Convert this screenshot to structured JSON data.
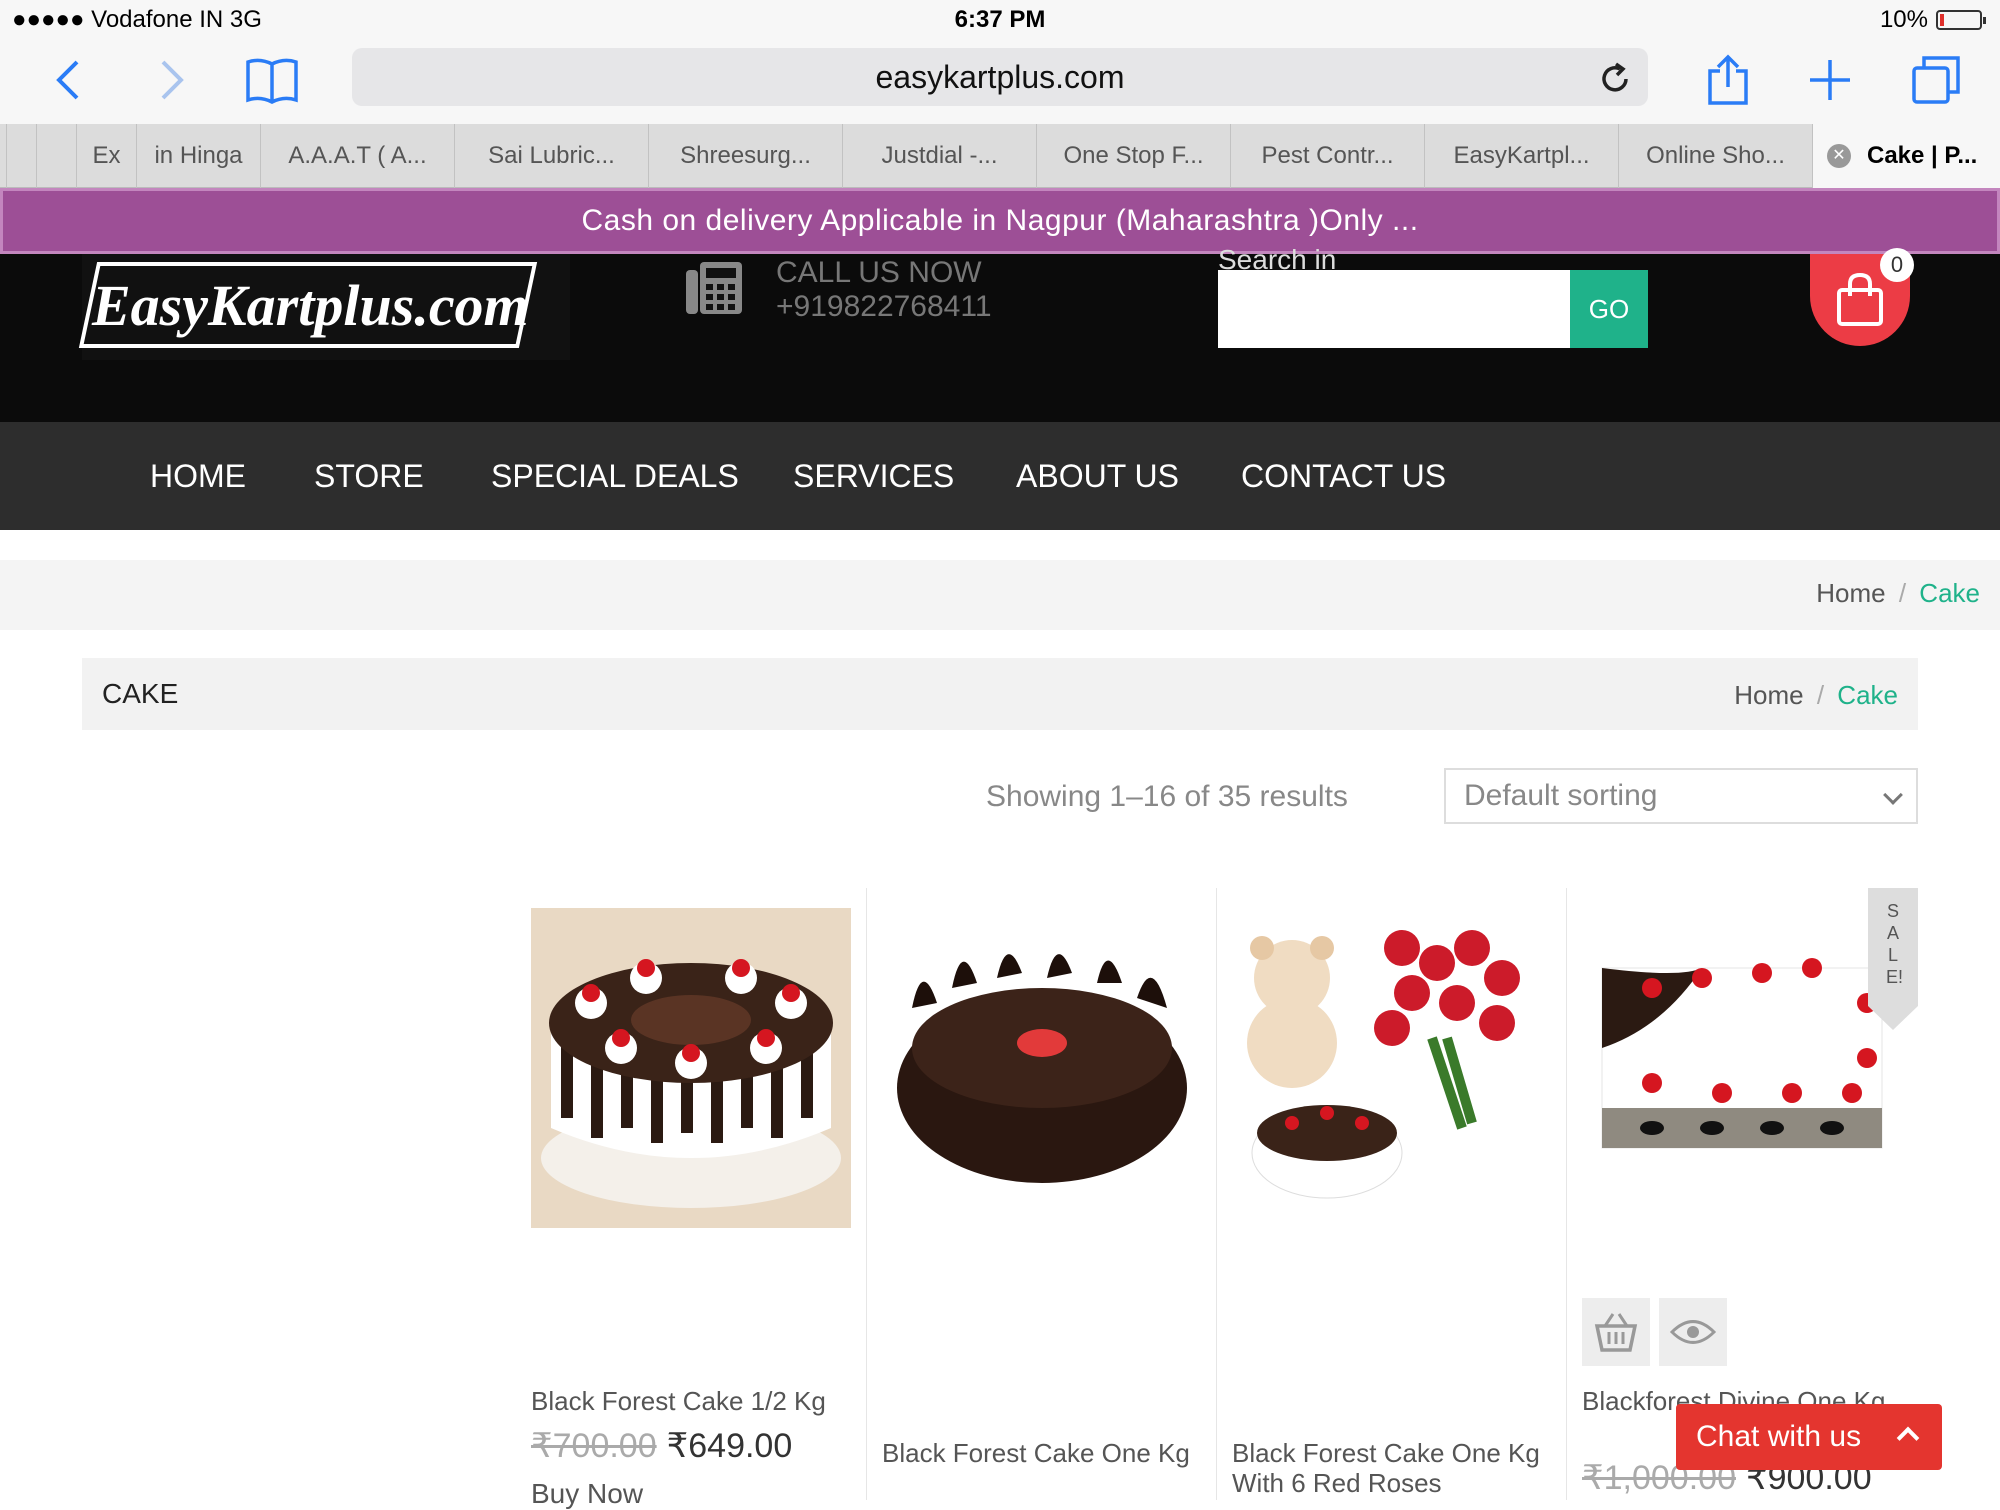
{
  "status": {
    "carrier": "●●●●● Vodafone IN  3G",
    "time": "6:37 PM",
    "battery": "10%",
    "battery_level": 0.1
  },
  "browser": {
    "url": "easykartplus.com",
    "tabs": [
      "Ex",
      "in Hinga",
      "A.A.A.T ( A...",
      "Sai Lubric...",
      "Shreesurg...",
      "Justdial -...",
      "One Stop F...",
      "Pest Contr...",
      "EasyKartpl...",
      "Online Sho...",
      "Cake | P..."
    ]
  },
  "notice": "Cash on delivery Applicable in Nagpur (Maharashtra )Only ...",
  "header": {
    "logo": "EasyKartplus.com",
    "call_label": "CALL US NOW",
    "call_number": "+919822768411",
    "search_label": "Search in",
    "go": "GO",
    "cart_count": "0"
  },
  "nav": [
    "HOME",
    "STORE",
    "SPECIAL DEALS",
    "SERVICES",
    "ABOUT US",
    "CONTACT US"
  ],
  "breadcrumb": {
    "home": "Home",
    "sep": "/",
    "current": "Cake"
  },
  "page": {
    "title": "CAKE",
    "results": "Showing 1–16 of 35 results",
    "sorting": "Default sorting"
  },
  "products": [
    {
      "name": "Black Forest Cake 1/2 Kg",
      "old_price": "₹700.00",
      "price": "₹649.00",
      "cta": "Buy Now"
    },
    {
      "name": "Black Forest Cake One Kg"
    },
    {
      "name": "Black Forest Cake One Kg With 6 Red Roses"
    },
    {
      "name": "Blackforest Divine One Kg",
      "old_price": "₹1,000.00",
      "price": "₹900.00",
      "sale": "SALE!"
    }
  ],
  "chat": "Chat with us",
  "colors": {
    "accent": "#1fb28a",
    "notice": "#9d4f96",
    "cart": "#ec3c45",
    "chat": "#e4352f",
    "nav": "#2d2d2d"
  }
}
